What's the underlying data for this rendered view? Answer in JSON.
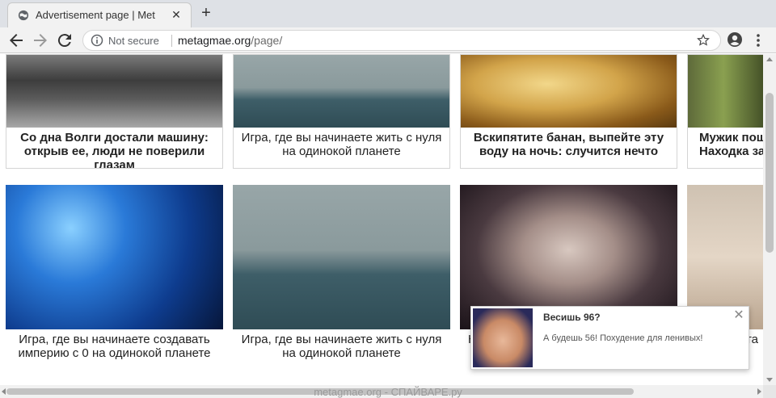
{
  "browser": {
    "tab_title": "Advertisement page | Met",
    "new_tab_label": "+",
    "tab_close_label": "✕",
    "security_label": "Not secure",
    "url_domain": "metagmae.org",
    "url_path": "/page/"
  },
  "cards": [
    {
      "caption": "Со дна Волги достали машину: открыв ее, люди не поверили глазам",
      "image": "car-photo"
    },
    {
      "caption": "Игра, где вы начинаете жить с нуля на одинокой планете",
      "image": "robots-photo"
    },
    {
      "caption": "Вскипятите банан, выпейте эту воду на ночь: случится нечто",
      "image": "banana-photo"
    },
    {
      "caption": "Мужик пош Находка за",
      "image": "forest-photo"
    },
    {
      "caption": "Игра, где вы начинаете создавать империю с 0 на одинокой планете",
      "image": "space-girl-photo"
    },
    {
      "caption": "Игра, где вы начинаете жить с нуля на одинокой планете",
      "image": "robots-photo"
    },
    {
      "caption": "Н",
      "image": "face-photo"
    },
    {
      "caption": "та",
      "image": "figure-photo"
    }
  ],
  "popup": {
    "title": "Весишь 96?",
    "text": "А будешь 56! Похудение для ленивых!",
    "close_label": "✕"
  },
  "footer": {
    "watermark": "metagmae.org - СПАЙВАРЕ.ру"
  }
}
